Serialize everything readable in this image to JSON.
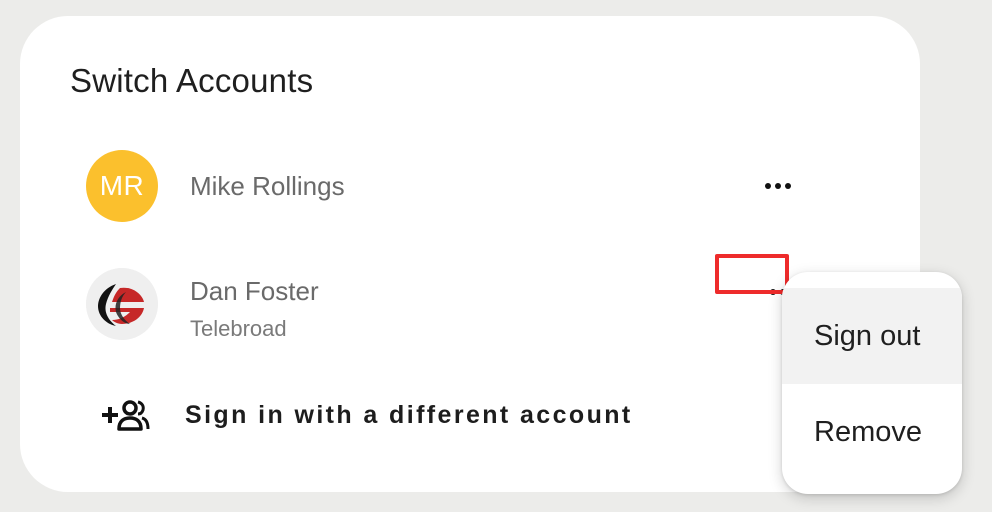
{
  "dialog": {
    "title": "Switch Accounts"
  },
  "accounts": [
    {
      "name": "Mike Rollings",
      "initials": "MR",
      "avatar_color": "#fbc02d",
      "more_icon": "more-horizontal-icon"
    },
    {
      "name": "Dan Foster",
      "organization": "Telebroad",
      "avatar_icon": "telebroad-logo",
      "more_icon": "more-horizontal-icon"
    }
  ],
  "sign_in_different": {
    "label": "Sign in with a different account",
    "icon": "add-account-icon"
  },
  "context_menu": {
    "items": [
      {
        "label": "Sign out",
        "state": "hovered"
      },
      {
        "label": "Remove"
      }
    ]
  },
  "highlight": {
    "color": "#ee2b2b",
    "target": "more-button-dan-foster"
  }
}
